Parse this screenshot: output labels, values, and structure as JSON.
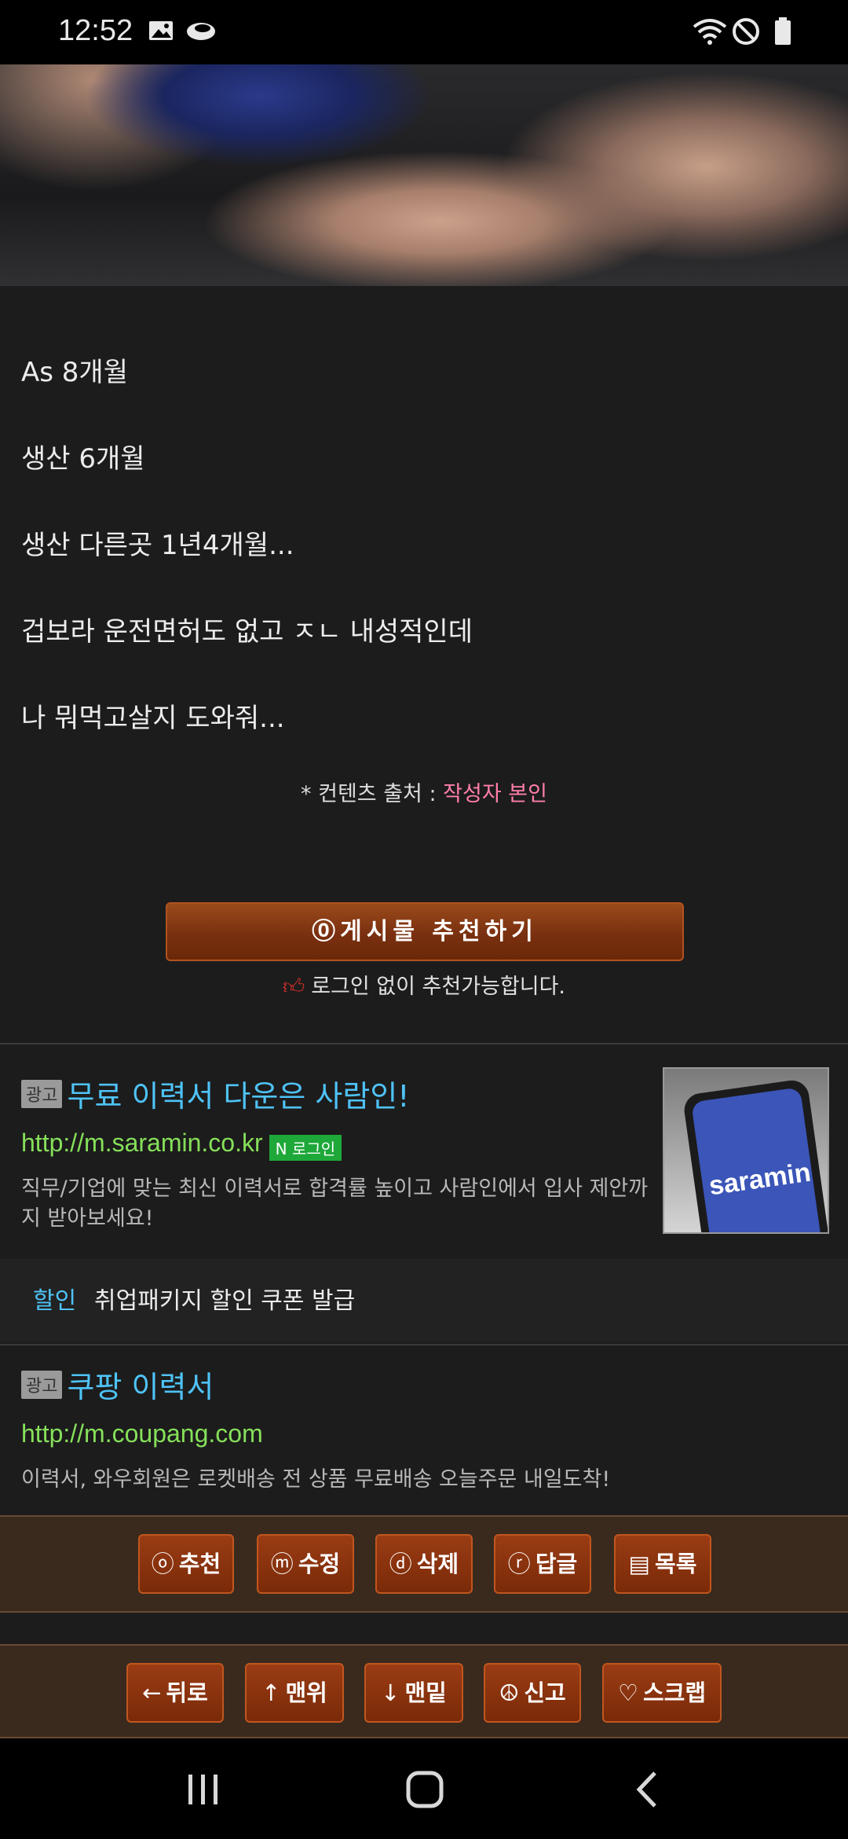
{
  "status_bar": {
    "time": "12:52"
  },
  "article": {
    "paragraphs": [
      "As 8개월",
      "생산 6개월",
      "생산 다른곳 1년4개월...",
      "겁보라 운전면허도 없고 ㅈㄴ 내성적인데",
      "나 뭐먹고살지 도와줘..."
    ],
    "source_prefix": "* 컨텐츠 출처 : ",
    "source_author": "작성자 본인",
    "recommend_button": "⓪게시물  추천하기",
    "recommend_note": "로그인 없이 추천가능합니다."
  },
  "ads": [
    {
      "tag": "광고",
      "title": "무료 이력서 다운은 사람인!",
      "url": "http://m.saramin.co.kr",
      "badge": "N 로그인",
      "description": "직무/기업에 맞는 최신 이력서로 합격률 높이고 사람인에서 입사 제안까지 받아보세요!",
      "thumb_text": "saramin",
      "coupon_tag": "할인",
      "coupon_text": "취업패키지 할인 쿠폰 발급"
    },
    {
      "tag": "광고",
      "title": "쿠팡 이력서",
      "url": "http://m.coupang.com",
      "description": "이력서, 와우회원은 로켓배송 전 상품 무료배송 오늘주문 내일도착!"
    }
  ],
  "toolbar_top": [
    {
      "icon": "ⓞ",
      "label": "추천"
    },
    {
      "icon": "ⓜ",
      "label": "수정"
    },
    {
      "icon": "ⓓ",
      "label": "삭제"
    },
    {
      "icon": "ⓡ",
      "label": "답글"
    },
    {
      "icon": "▤",
      "label": "목록"
    }
  ],
  "toolbar_bottom": [
    {
      "icon": "←",
      "label": "뒤로"
    },
    {
      "icon": "↑",
      "label": "맨위"
    },
    {
      "icon": "↓",
      "label": "맨밑"
    },
    {
      "icon": "☮",
      "label": "신고"
    },
    {
      "icon": "♡",
      "label": "스크랩"
    }
  ],
  "colors": {
    "accent_button": "#7a3010",
    "ad_title": "#4fc3f7",
    "ad_url": "#86e05a",
    "source_author": "#ff7fa8"
  }
}
